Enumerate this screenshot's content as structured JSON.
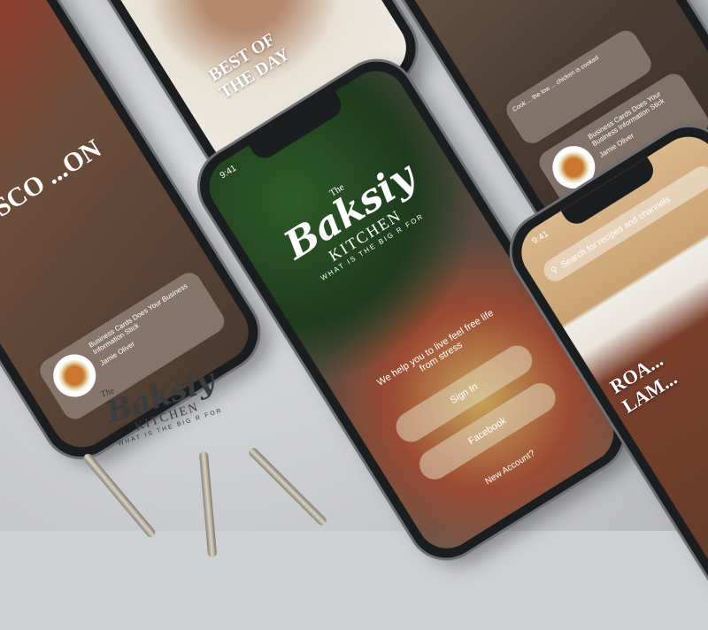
{
  "logo": {
    "the": "The",
    "brand": "Baksiy",
    "kitchen": "KITCHEN",
    "tagline": "WHAT IS THE BIG R FOR"
  },
  "main_phone": {
    "time": "9:41",
    "tagline": "We help you to live feel free life from stress",
    "sign_in": "Sign In",
    "facebook": "Facebook",
    "new_account": "New Account?"
  },
  "top_left_phone": {
    "headline": "BEST OF THE DAY"
  },
  "top_right_phone": {
    "note": "Cook ... the low ... chicken is cooked",
    "card_title": "Business Cards Does Your Business Information Stick",
    "author": "Jamie Oliver"
  },
  "left_phone": {
    "headline": "...CISCO ...ON",
    "card_title": "Business Cards Does Your Business Information Stick",
    "author": "Jamie Oliver"
  },
  "right_phone": {
    "time": "9:41",
    "search_placeholder": "Search for recipes and channels",
    "headline": "ROA... LAM..."
  },
  "colors": {
    "table": "#cfd0d3",
    "phone_frame": "#1c1d1f",
    "card": "#968779"
  }
}
